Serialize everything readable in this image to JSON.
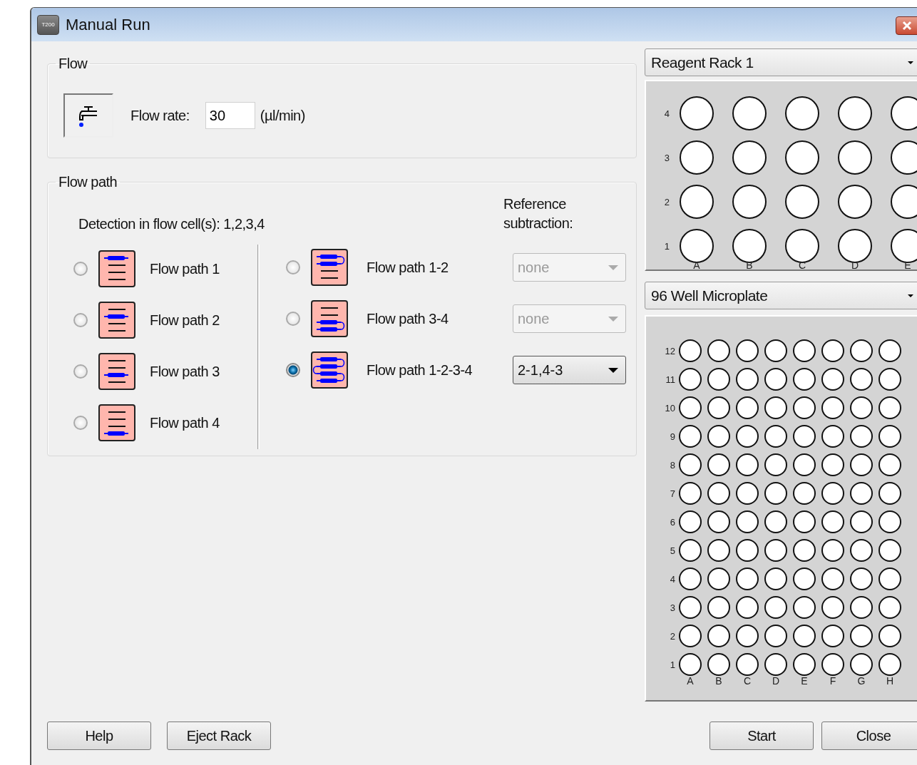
{
  "window": {
    "title": "Manual Run",
    "icon_text": "T200"
  },
  "flow": {
    "title": "Flow",
    "label": "Flow rate:",
    "value": "30",
    "unit": "(µl/min)"
  },
  "flow_path": {
    "title": "Flow path",
    "detection": "Detection in flow cell(s): 1,2,3,4",
    "reference_header": "Reference subtraction:",
    "single_paths": [
      {
        "label": "Flow path 1",
        "selected": false
      },
      {
        "label": "Flow path 2",
        "selected": false
      },
      {
        "label": "Flow path 3",
        "selected": false
      },
      {
        "label": "Flow path 4",
        "selected": false
      }
    ],
    "multi_paths": [
      {
        "label": "Flow path 1-2",
        "selected": false,
        "reference": {
          "value": "none",
          "disabled": true
        }
      },
      {
        "label": "Flow path 3-4",
        "selected": false,
        "reference": {
          "value": "none",
          "disabled": true
        }
      },
      {
        "label": "Flow path 1-2-3-4",
        "selected": true,
        "reference": {
          "value": "2-1,4-3",
          "disabled": false
        }
      }
    ]
  },
  "racks": [
    {
      "name": "Reagent Rack 1",
      "kind": "large",
      "rows": [
        "4",
        "3",
        "2",
        "1"
      ],
      "columns": [
        "A",
        "B",
        "C",
        "D",
        "E"
      ]
    },
    {
      "name": "96 Well Microplate",
      "kind": "small",
      "rows": [
        "12",
        "11",
        "10",
        "9",
        "8",
        "7",
        "6",
        "5",
        "4",
        "3",
        "2",
        "1"
      ],
      "columns": [
        "A",
        "B",
        "C",
        "D",
        "E",
        "F",
        "G",
        "H"
      ]
    }
  ],
  "left_buttons": [
    "Help",
    "Eject Rack"
  ],
  "right_buttons": [
    "Start",
    "Close"
  ]
}
